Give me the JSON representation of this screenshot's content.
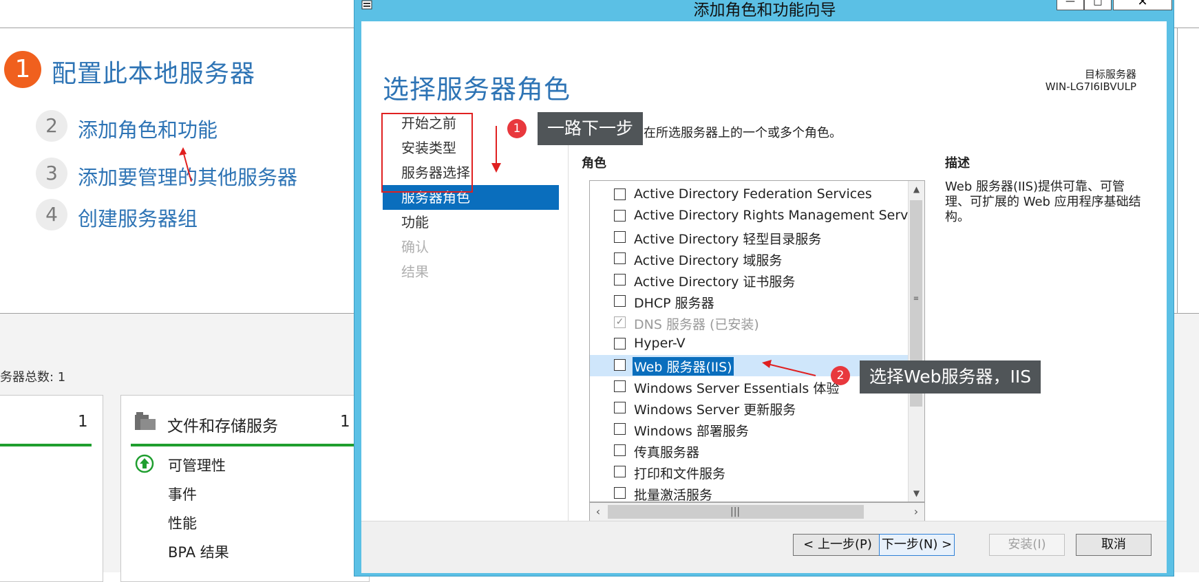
{
  "background": {
    "step1": {
      "num": "1",
      "label": "配置此本地服务器"
    },
    "steps": [
      {
        "num": "2",
        "label": "添加角色和功能"
      },
      {
        "num": "3",
        "label": "添加要管理的其他服务器"
      },
      {
        "num": "4",
        "label": "创建服务器组"
      }
    ],
    "server_count": "务器总数: 1",
    "tile_left": {
      "count": "1"
    },
    "tile_files": {
      "title": "文件和存储服务",
      "count": "1",
      "items": [
        "可管理性",
        "事件",
        "性能",
        "BPA 结果"
      ]
    }
  },
  "wizard": {
    "title": "添加角色和功能向导",
    "page_title": "选择服务器角色",
    "target_label": "目标服务器",
    "target_value": "WIN-LG7I6IBVULP",
    "nav": [
      {
        "label": "开始之前",
        "state": "normal"
      },
      {
        "label": "安装类型",
        "state": "normal"
      },
      {
        "label": "服务器选择",
        "state": "normal"
      },
      {
        "label": "服务器角色",
        "state": "active"
      },
      {
        "label": "功能",
        "state": "normal"
      },
      {
        "label": "确认",
        "state": "disabled"
      },
      {
        "label": "结果",
        "state": "disabled"
      }
    ],
    "instruction": "选择要安装在所选服务器上的一个或多个角色。",
    "roles_header": "角色",
    "description_header": "描述",
    "description": "Web 服务器(IIS)提供可靠、可管理、可扩展的 Web 应用程序基础结构。",
    "roles": [
      {
        "label": "Active Directory Federation Services",
        "checked": false,
        "disabled": false
      },
      {
        "label": "Active Directory Rights Management Services",
        "checked": false,
        "disabled": false
      },
      {
        "label": "Active Directory 轻型目录服务",
        "checked": false,
        "disabled": false
      },
      {
        "label": "Active Directory 域服务",
        "checked": false,
        "disabled": false
      },
      {
        "label": "Active Directory 证书服务",
        "checked": false,
        "disabled": false
      },
      {
        "label": "DHCP 服务器",
        "checked": false,
        "disabled": false
      },
      {
        "label": "DNS 服务器 (已安装)",
        "checked": true,
        "disabled": true
      },
      {
        "label": "Hyper-V",
        "checked": false,
        "disabled": false
      },
      {
        "label": "Web 服务器(IIS)",
        "checked": false,
        "disabled": false,
        "selected": true
      },
      {
        "label": "Windows Server Essentials 体验",
        "checked": false,
        "disabled": false
      },
      {
        "label": "Windows Server 更新服务",
        "checked": false,
        "disabled": false
      },
      {
        "label": "Windows 部署服务",
        "checked": false,
        "disabled": false
      },
      {
        "label": "传真服务器",
        "checked": false,
        "disabled": false
      },
      {
        "label": "打印和文件服务",
        "checked": false,
        "disabled": false
      },
      {
        "label": "批量激活服务",
        "checked": false,
        "disabled": false
      }
    ],
    "buttons": {
      "prev": "< 上一步(P)",
      "next": "下一步(N) >",
      "install": "安装(I)",
      "cancel": "取消"
    },
    "window_buttons": {
      "minimize": "—",
      "maximize": "□",
      "close": "✕"
    }
  },
  "annotations": {
    "badge1": "1",
    "callout1": "一路下一步",
    "badge2": "2",
    "callout2": "选择Web服务器，IIS"
  },
  "colors": {
    "accent": "#2e74b5",
    "selection": "#0a6ebd",
    "titlebar": "#5bc0e5",
    "step1": "#f0601e",
    "annotation_red": "#e8383d",
    "status_green": "#1f9e2f"
  }
}
